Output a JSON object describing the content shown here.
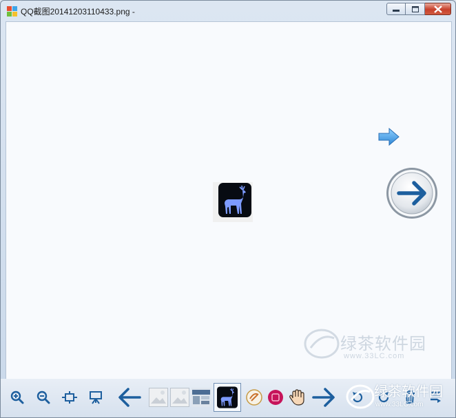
{
  "window": {
    "title": "QQ截图20141203110433.png -"
  },
  "viewer": {
    "image_icon": "deer-icon",
    "next_small_icon": "arrow-right-icon",
    "next_big_icon": "circle-arrow-right-icon"
  },
  "watermark": {
    "text": "绿茶软件园",
    "url": "www.33LC.com"
  },
  "toolbar": {
    "zoom_in_icon": "zoom-in-icon",
    "zoom_out_icon": "zoom-out-icon",
    "fit_icon": "fit-window-icon",
    "slideshow_icon": "slideshow-icon",
    "prev_icon": "arrow-left-icon",
    "next_icon": "arrow-right-icon",
    "rotate_ccw_icon": "rotate-ccw-icon",
    "rotate_cw_icon": "rotate-cw-icon",
    "delete_icon": "trash-icon",
    "menu_icon": "menu-icon"
  },
  "colors": {
    "accent_blue": "#1d5f9e",
    "arrow_light": "#3c9be0",
    "deer": "#7d9bff"
  }
}
